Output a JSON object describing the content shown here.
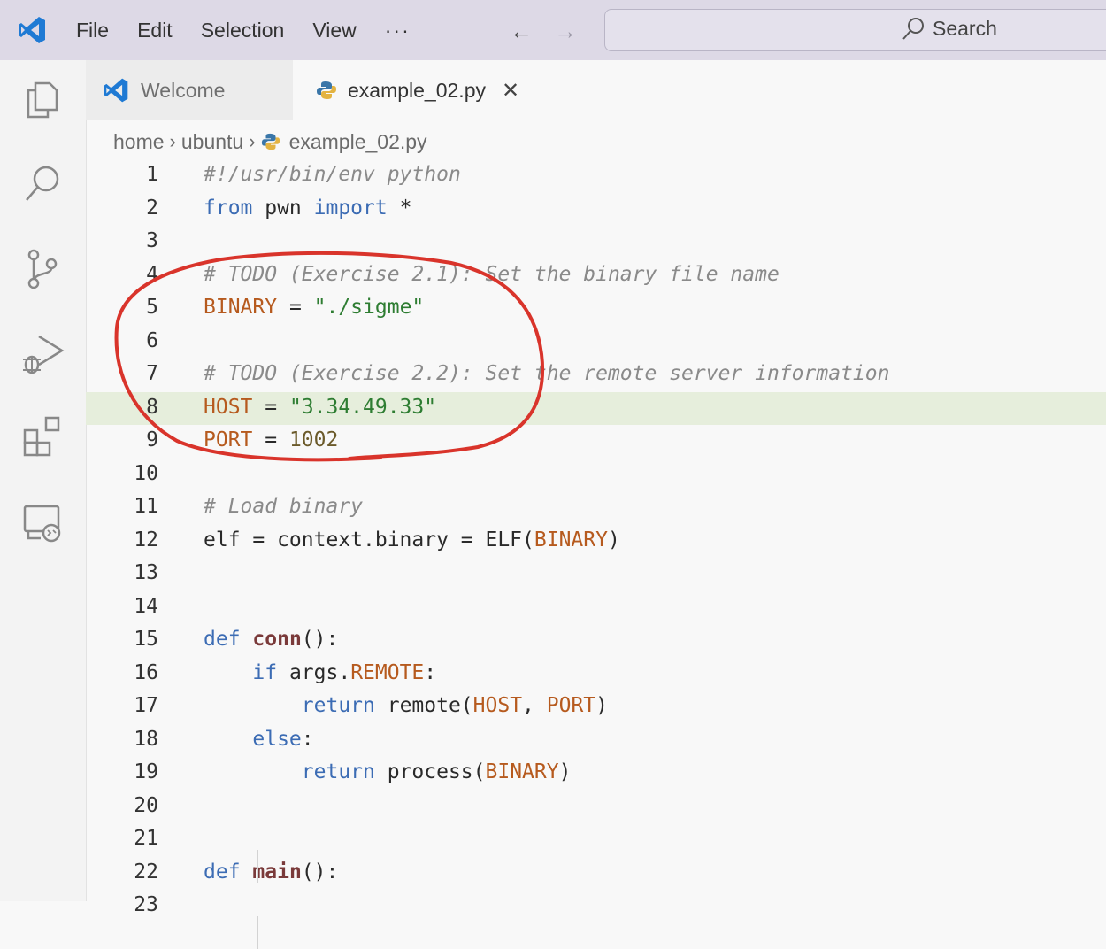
{
  "titlebar": {
    "menu": [
      "File",
      "Edit",
      "Selection",
      "View"
    ],
    "more_label": "···",
    "back_label": "←",
    "forward_label": "→",
    "search_label": "Search"
  },
  "tabs": {
    "welcome": "Welcome",
    "file": "example_02.py",
    "close_label": "✕"
  },
  "breadcrumb": [
    "home",
    "ubuntu",
    "example_02.py"
  ],
  "breadcrumb_sep": "›",
  "editor": {
    "highlighted_line": 8,
    "lines": [
      {
        "n": "1",
        "tokens": [
          [
            "cmt",
            "#!/usr/bin/env python"
          ]
        ]
      },
      {
        "n": "2",
        "tokens": [
          [
            "kw",
            "from"
          ],
          [
            "var",
            " pwn "
          ],
          [
            "kw",
            "import"
          ],
          [
            "var",
            " *"
          ]
        ]
      },
      {
        "n": "3",
        "tokens": []
      },
      {
        "n": "4",
        "tokens": [
          [
            "cmt",
            "# TODO (Exercise 2.1): Set the binary file name"
          ]
        ]
      },
      {
        "n": "5",
        "tokens": [
          [
            "const",
            "BINARY"
          ],
          [
            "var",
            " = "
          ],
          [
            "str",
            "\"./sigme\""
          ]
        ]
      },
      {
        "n": "6",
        "tokens": []
      },
      {
        "n": "7",
        "tokens": [
          [
            "cmt",
            "# TODO (Exercise 2.2): Set the remote server information"
          ]
        ]
      },
      {
        "n": "8",
        "tokens": [
          [
            "const",
            "HOST"
          ],
          [
            "var",
            " = "
          ],
          [
            "str",
            "\"3.34.49.33\""
          ]
        ]
      },
      {
        "n": "9",
        "tokens": [
          [
            "const",
            "PORT"
          ],
          [
            "var",
            " = "
          ],
          [
            "num",
            "1002"
          ]
        ]
      },
      {
        "n": "10",
        "tokens": []
      },
      {
        "n": "11",
        "tokens": [
          [
            "cmt",
            "# Load binary"
          ]
        ]
      },
      {
        "n": "12",
        "tokens": [
          [
            "var",
            "elf = context.binary = ELF("
          ],
          [
            "const",
            "BINARY"
          ],
          [
            "var",
            ")"
          ]
        ]
      },
      {
        "n": "13",
        "tokens": []
      },
      {
        "n": "14",
        "tokens": []
      },
      {
        "n": "15",
        "tokens": [
          [
            "kw",
            "def"
          ],
          [
            "var",
            " "
          ],
          [
            "fn",
            "conn"
          ],
          [
            "var",
            "():"
          ]
        ]
      },
      {
        "n": "16",
        "tokens": [
          [
            "var",
            "    "
          ],
          [
            "kw",
            "if"
          ],
          [
            "var",
            " args."
          ],
          [
            "const",
            "REMOTE"
          ],
          [
            "var",
            ":"
          ]
        ]
      },
      {
        "n": "17",
        "tokens": [
          [
            "var",
            "        "
          ],
          [
            "kw",
            "return"
          ],
          [
            "var",
            " remote("
          ],
          [
            "const",
            "HOST"
          ],
          [
            "var",
            ", "
          ],
          [
            "const",
            "PORT"
          ],
          [
            "var",
            ")"
          ]
        ]
      },
      {
        "n": "18",
        "tokens": [
          [
            "var",
            "    "
          ],
          [
            "kw",
            "else"
          ],
          [
            "var",
            ":"
          ]
        ]
      },
      {
        "n": "19",
        "tokens": [
          [
            "var",
            "        "
          ],
          [
            "kw",
            "return"
          ],
          [
            "var",
            " process("
          ],
          [
            "const",
            "BINARY"
          ],
          [
            "var",
            ")"
          ]
        ]
      },
      {
        "n": "20",
        "tokens": []
      },
      {
        "n": "21",
        "tokens": []
      },
      {
        "n": "22",
        "tokens": [
          [
            "kw",
            "def"
          ],
          [
            "var",
            " "
          ],
          [
            "fn",
            "main"
          ],
          [
            "var",
            "():"
          ]
        ]
      },
      {
        "n": "23",
        "tokens": []
      }
    ]
  },
  "colors": {
    "titlebar_bg": "#ddd9e6",
    "accent_blue": "#1f7ad4",
    "annotation_red": "#d9342b",
    "line_highlight": "#e6eedc"
  },
  "icons": [
    "vscode-logo-icon",
    "explorer-icon",
    "search-icon",
    "source-control-icon",
    "run-debug-icon",
    "extensions-icon",
    "remote-explorer-icon",
    "python-file-icon"
  ]
}
